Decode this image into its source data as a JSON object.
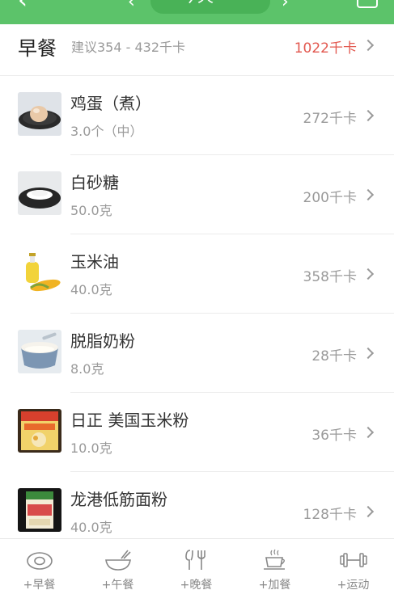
{
  "topbar": {
    "prev_icon": "chevron-left-icon",
    "date_label": "今天",
    "calendar_icon": "calendar-icon"
  },
  "meal": {
    "title": "早餐",
    "suggestion": "建议354 - 432千卡",
    "total": "1022千卡",
    "total_color": "#e2584f"
  },
  "foods": [
    {
      "name": "鸡蛋（煮）",
      "amount": "3.0个（中）",
      "calories": "272千卡",
      "icon": "boiled-egg-image"
    },
    {
      "name": "白砂糖",
      "amount": "50.0克",
      "calories": "200千卡",
      "icon": "white-sugar-image"
    },
    {
      "name": "玉米油",
      "amount": "40.0克",
      "calories": "358千卡",
      "icon": "corn-oil-image"
    },
    {
      "name": "脱脂奶粉",
      "amount": "8.0克",
      "calories": "28千卡",
      "icon": "skim-milk-powder-image"
    },
    {
      "name": "日正 美国玉米粉",
      "amount": "10.0克",
      "calories": "36千卡",
      "icon": "corn-flour-package-image"
    },
    {
      "name": "龙港低筋面粉",
      "amount": "40.0克",
      "calories": "128千卡",
      "icon": "cake-flour-package-image"
    }
  ],
  "tabs": [
    {
      "label": "+早餐",
      "icon": "egg-icon"
    },
    {
      "label": "+午餐",
      "icon": "bowl-icon"
    },
    {
      "label": "+晚餐",
      "icon": "fork-knife-icon"
    },
    {
      "label": "+加餐",
      "icon": "coffee-cup-icon"
    },
    {
      "label": "+运动",
      "icon": "dumbbell-icon"
    }
  ],
  "colors": {
    "accent": "#5cc36a",
    "accent_dark": "#49b257"
  }
}
